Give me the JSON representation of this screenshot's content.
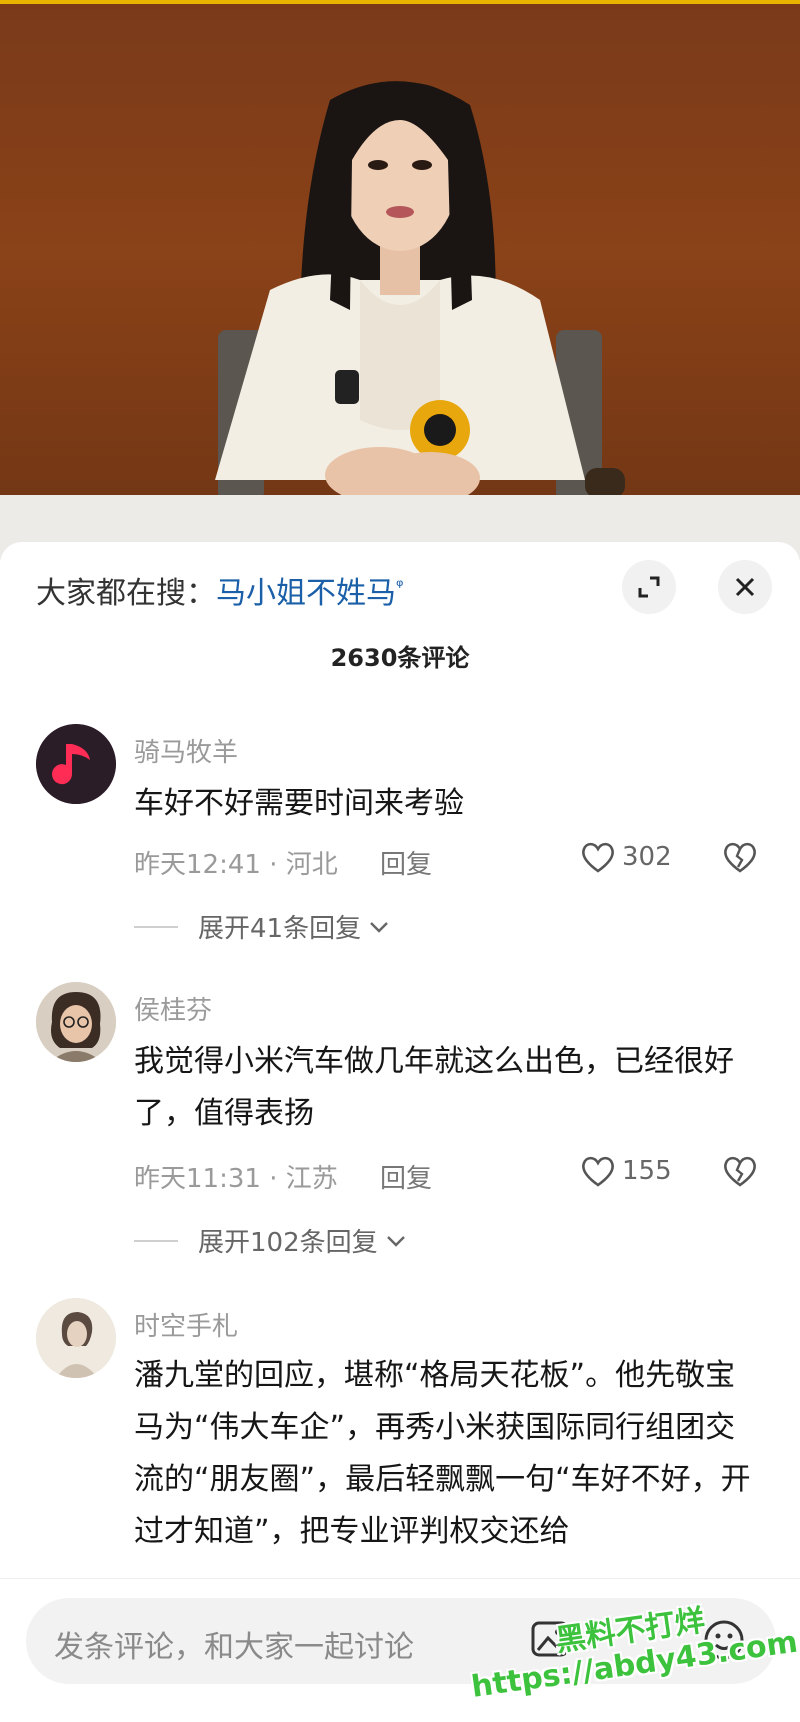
{
  "search_hint": {
    "prefix": "大家都在搜：",
    "keyword": "马小姐不姓马",
    "suffix_icon": "search-icon"
  },
  "comment_count": "2630条评论",
  "comments": [
    {
      "username": "骑马牧羊",
      "text": "车好不好需要时间来考验",
      "time_location": "昨天12:41 · 河北",
      "reply_label": "回复",
      "likes": "302",
      "expand_label": "展开41条回复",
      "avatar": "music-note-avatar"
    },
    {
      "username": "侯桂芬",
      "text": "我觉得小米汽车做几年就这么出色，已经很好了，值得表扬",
      "time_location": "昨天11:31 · 江苏",
      "reply_label": "回复",
      "likes": "155",
      "expand_label": "展开102条回复",
      "avatar": "woman-glasses-avatar"
    },
    {
      "username": "时空手札",
      "text": "潘九堂的回应，堪称“格局天花板”。他先敬宝马为“伟大车企”，再秀小米获国际同行组团交流的“朋友圈”，最后轻飘飘一句“车好不好，开过才知道”，把专业评判权交还给",
      "avatar": "sketch-portrait-avatar"
    }
  ],
  "input": {
    "placeholder": "发条评论，和大家一起讨论"
  },
  "watermark": {
    "line1": "黑料不打烊",
    "line2": "https://abdy43.com"
  },
  "colors": {
    "keyword": "#1a5fa8",
    "watermark": "#3cc23c",
    "video_bg": "#8a4218"
  }
}
